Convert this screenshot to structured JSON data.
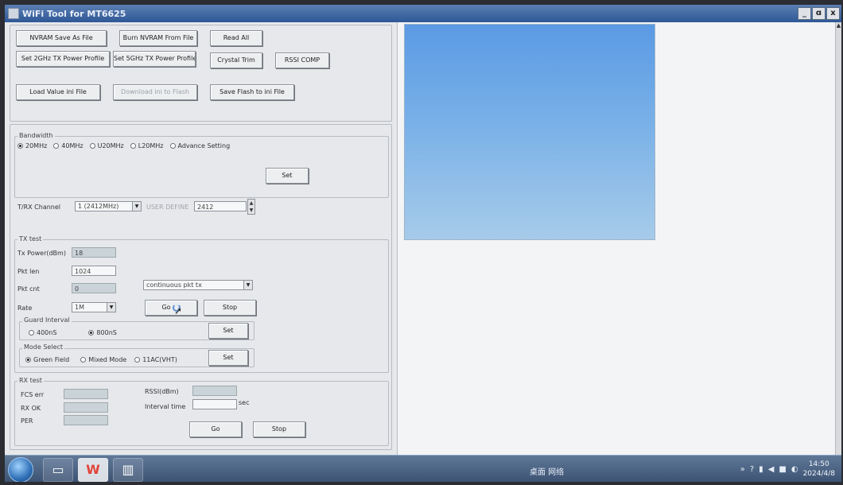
{
  "window": {
    "title": "WiFi Tool for MT6625",
    "min": "_",
    "max": "ɑ",
    "close": "x"
  },
  "toolbar": {
    "nvram_save": "NVRAM Save As File",
    "burn_nvram": "Burn NVRAM From File",
    "read_all": "Read All",
    "set_2g": "Set 2GHz TX Power Profile",
    "set_5g": "Set 5GHz TX Power Profile",
    "crystal_trim": "Crystal Trim",
    "rssi_comp": "RSSI COMP",
    "load_ini": "Load Value ini File",
    "download_ini": "Download ini to Flash",
    "save_flash": "Save Flash to ini File"
  },
  "bandwidth": {
    "title": "Bandwidth",
    "options": [
      "20MHz",
      "40MHz",
      "U20MHz",
      "L20MHz",
      "Advance Setting"
    ],
    "selected": "20MHz",
    "set_label": "Set"
  },
  "channel": {
    "label": "T/RX Channel",
    "value": "1 (2412MHz)",
    "user_define_label": "USER DEFINE",
    "user_define_value": "2412"
  },
  "tx_test": {
    "title": "TX test",
    "tx_power_label": "Tx Power(dBm)",
    "tx_power_value": "18",
    "pkt_len_label": "Pkt len",
    "pkt_len_value": "1024",
    "pkt_cnt_label": "Pkt cnt",
    "pkt_cnt_value": "0",
    "mode_value": "continuous pkt tx",
    "rate_label": "Rate",
    "rate_value": "1M",
    "go_label": "Go",
    "stop_label": "Stop",
    "guard_interval": {
      "title": "Guard Interval",
      "options": [
        "400nS",
        "800nS"
      ],
      "selected": "800nS",
      "set_label": "Set"
    },
    "mode_select": {
      "title": "Mode Select",
      "options": [
        "Green Field",
        "Mixed Mode",
        "11AC(VHT)"
      ],
      "selected": "Green Field",
      "set_label": "Set"
    }
  },
  "rx_test": {
    "title": "RX test",
    "fcs_err_label": "FCS err",
    "rx_ok_label": "RX OK",
    "per_label": "PER",
    "rssi_label": "RSSI(dBm)",
    "interval_label": "Interval time",
    "interval_unit": "sec",
    "go_label": "Go",
    "stop_label": "Stop"
  },
  "taskbar": {
    "tray_text": "桌面 网络",
    "time": "14:50",
    "date": "2024/4/8"
  },
  "colors": {
    "titlebar": "#2e5796",
    "preview": "#5b9ae4"
  }
}
